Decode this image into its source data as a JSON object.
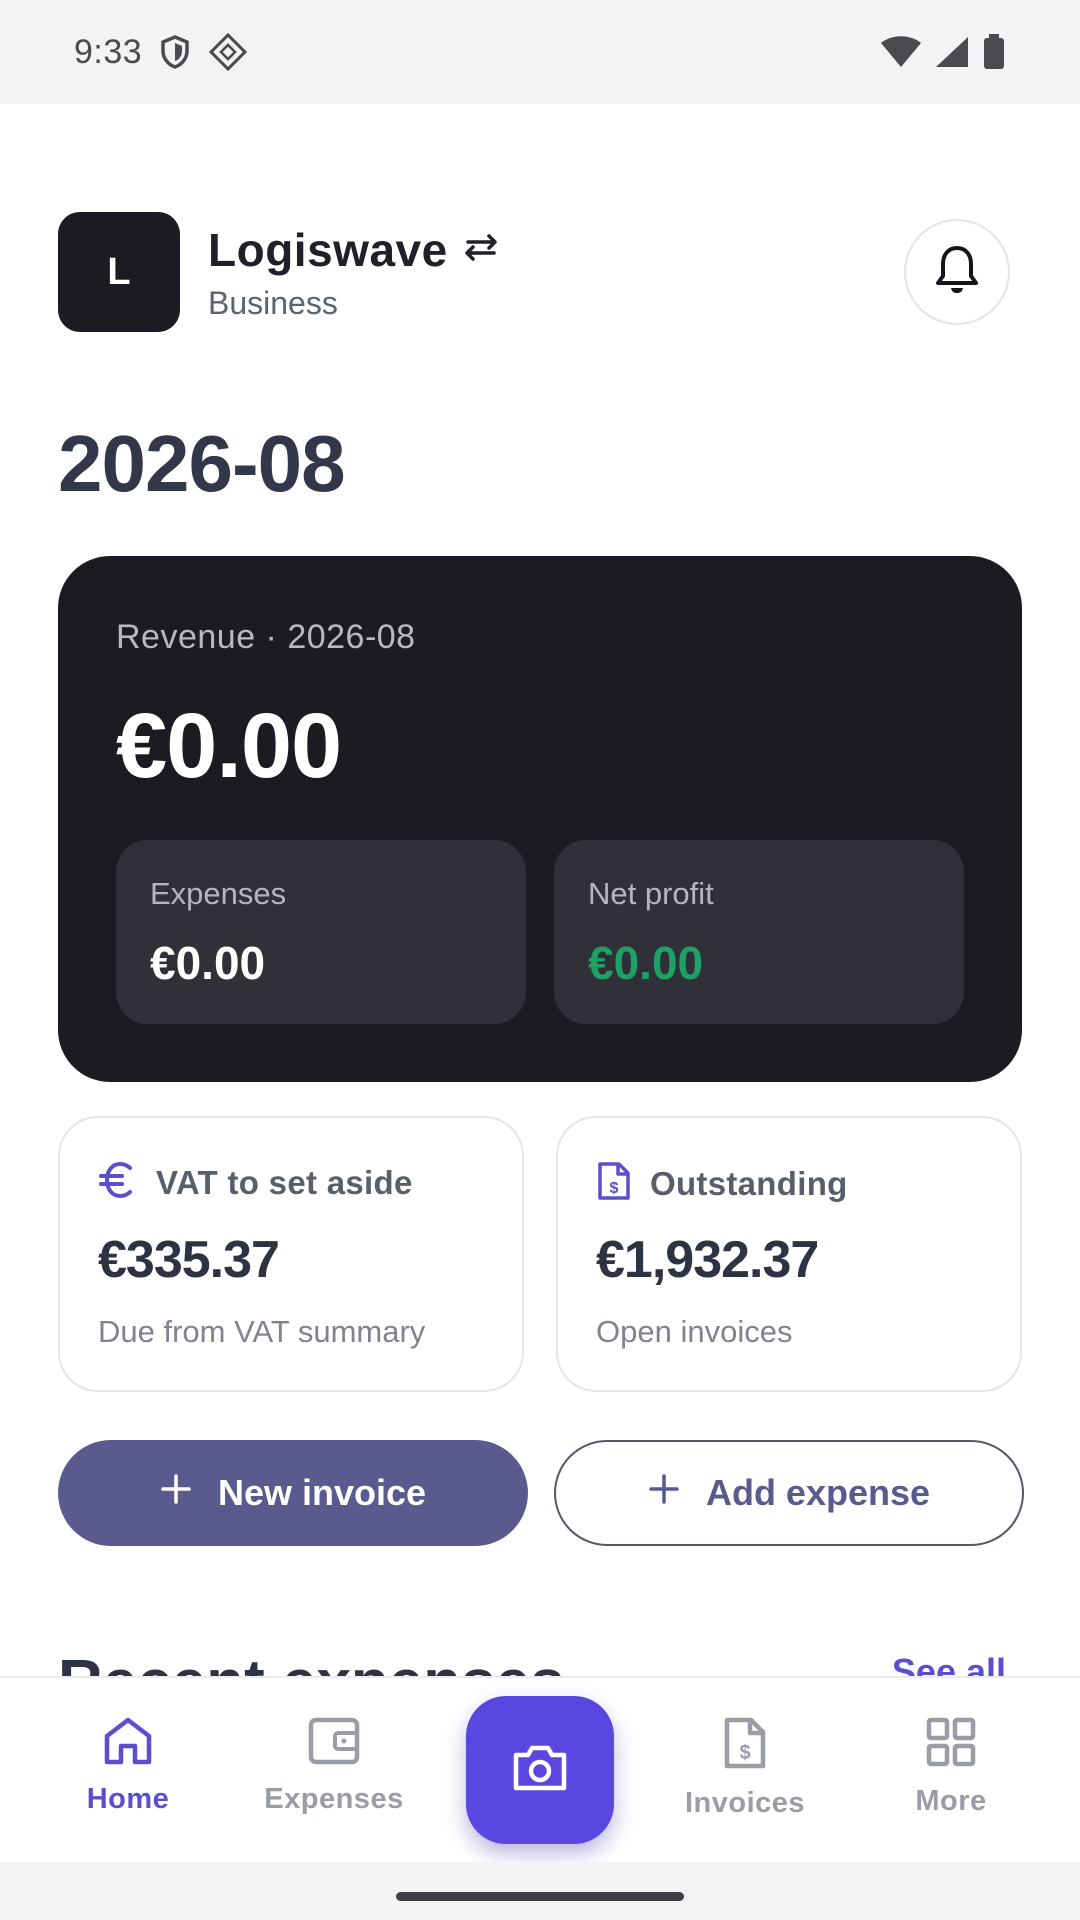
{
  "status_bar": {
    "time": "9:33"
  },
  "header": {
    "avatar_letter": "L",
    "org_name": "Logiswave",
    "org_type": "Business"
  },
  "period_title": "2026-08",
  "revenue_card": {
    "label": "Revenue · 2026-08",
    "value": "€0.00",
    "expenses_label": "Expenses",
    "expenses_value": "€0.00",
    "net_profit_label": "Net profit",
    "net_profit_value": "€0.00"
  },
  "stats": {
    "vat": {
      "title": "VAT to set aside",
      "value": "€335.37",
      "subtitle": "Due from VAT summary",
      "icon": "euro-icon"
    },
    "outstanding": {
      "title": "Outstanding",
      "value": "€1,932.37",
      "subtitle": "Open invoices",
      "icon": "invoice-dollar-icon"
    }
  },
  "actions": {
    "new_invoice": "New invoice",
    "add_expense": "Add expense"
  },
  "recent": {
    "title": "Recent expenses",
    "see_all": "See all"
  },
  "nav": {
    "items": [
      {
        "label": "Home",
        "icon": "home-icon",
        "active": true
      },
      {
        "label": "Expenses",
        "icon": "wallet-icon",
        "active": false
      },
      {
        "label": "Invoices",
        "icon": "invoice-icon",
        "active": false
      },
      {
        "label": "More",
        "icon": "grid-icon",
        "active": false
      }
    ],
    "fab_icon": "camera-icon"
  },
  "colors": {
    "accent": "#5b46e0",
    "primary_button": "#5b5a8f",
    "dark_card": "#1b1c21",
    "profit_green": "#1fa064"
  }
}
